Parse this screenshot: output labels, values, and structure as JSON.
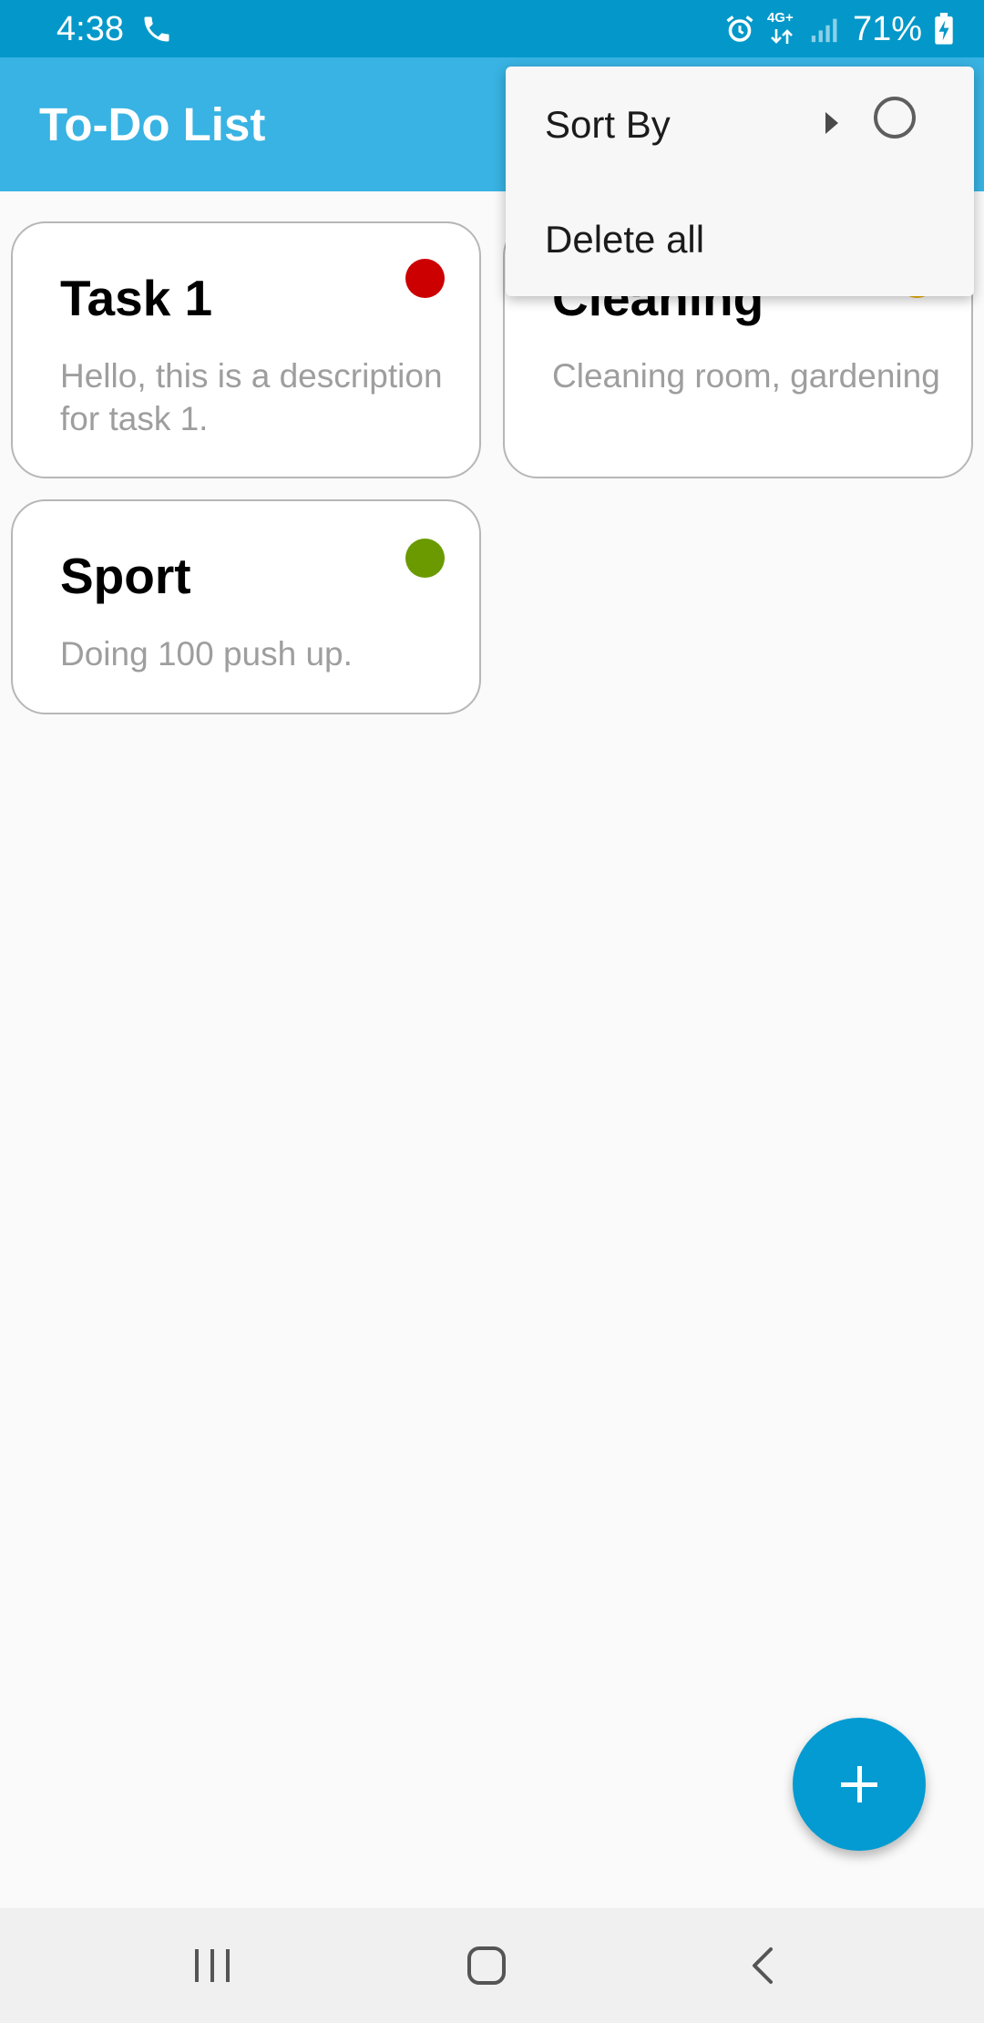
{
  "status_bar": {
    "time": "4:38",
    "network_label": "4G+",
    "battery": "71%",
    "icons": [
      "phone-icon",
      "alarm-icon",
      "network-4g-icon",
      "signal-icon",
      "battery-charging-icon"
    ]
  },
  "app_bar": {
    "title": "To-Do List"
  },
  "tasks": [
    {
      "title": "Task 1",
      "description": "Hello, this is a description for task 1.",
      "priority_color": "#cc0000"
    },
    {
      "title": "Cleaning",
      "description": "Cleaning room, gardening",
      "priority_color": "#f2b400"
    },
    {
      "title": "Sport",
      "description": "Doing 100 push up.",
      "priority_color": "#6a9a00"
    }
  ],
  "menu": {
    "items": [
      {
        "label": "Sort By",
        "has_submenu": true,
        "radio_checked": false
      },
      {
        "label": "Delete all"
      }
    ]
  },
  "fab": {
    "icon": "plus-icon"
  },
  "nav_bar": {
    "buttons": [
      "recents-icon",
      "home-icon",
      "back-icon"
    ]
  },
  "colors": {
    "status_bar": "#0398c9",
    "app_bar": "#38b3e3",
    "fab": "#039bd1",
    "background": "#fafafa"
  }
}
